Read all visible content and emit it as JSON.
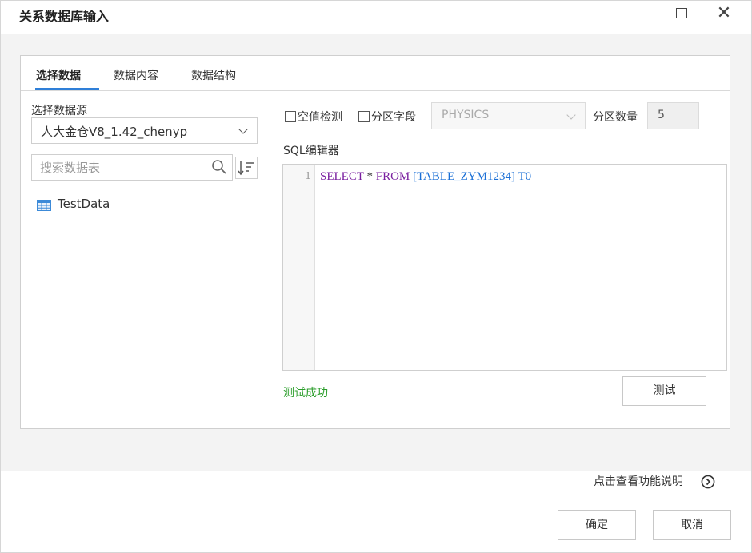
{
  "window": {
    "title": "关系数据库输入",
    "maximize_icon": "maximize-icon",
    "close_icon": "close-icon",
    "close_glyph": "✕"
  },
  "tabs": [
    {
      "label": "选择数据",
      "active": true
    },
    {
      "label": "数据内容",
      "active": false
    },
    {
      "label": "数据结构",
      "active": false
    }
  ],
  "left_panel": {
    "datasource_label": "选择数据源",
    "datasource_value": "人大金仓V8_1.42_chenyp",
    "search_placeholder": "搜索数据表",
    "tables": [
      {
        "name": "TestData",
        "icon": "table-icon"
      }
    ]
  },
  "right_panel": {
    "null_check_label": "空值检测",
    "null_check_checked": false,
    "partition_field_label": "分区字段",
    "partition_field_checked": false,
    "partition_field_value": "PHYSICS",
    "partition_count_label": "分区数量",
    "partition_count_value": "5",
    "sql_editor_label": "SQL编辑器",
    "sql_lines": [
      {
        "number": "1",
        "tokens": {
          "kw1": "SELECT",
          "star": "*",
          "kw2": "FROM",
          "table": "[TABLE_ZYM1234]",
          "alias": "T0"
        }
      }
    ],
    "status_text": "测试成功",
    "test_button_label": "测试"
  },
  "footer": {
    "help_text": "点击查看功能说明",
    "help_icon": "arrow-right-circle-icon",
    "ok_label": "确定",
    "cancel_label": "取消"
  },
  "colors": {
    "accent": "#2f7fd8",
    "success": "#2a9d2a",
    "sql_keyword": "#7a1fa0",
    "sql_table": "#1a6fd6"
  }
}
